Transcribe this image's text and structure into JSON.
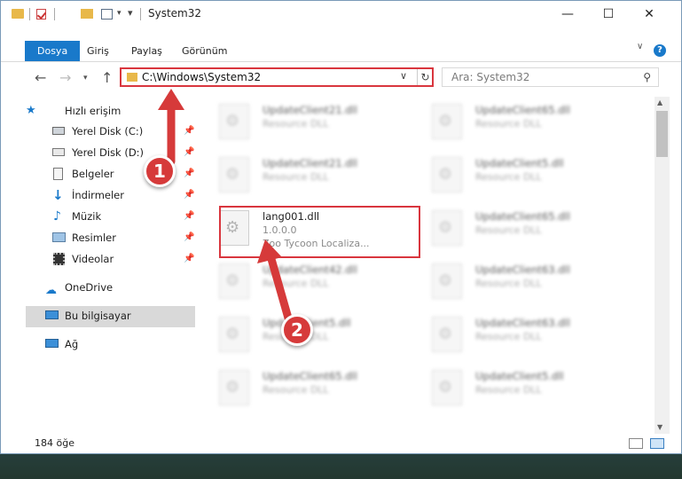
{
  "window": {
    "title": "System32"
  },
  "ribbon": {
    "tabs": [
      "Dosya",
      "Giriş",
      "Paylaş",
      "Görünüm"
    ]
  },
  "address": {
    "path": "C:\\Windows\\System32"
  },
  "search": {
    "placeholder": "Ara: System32"
  },
  "sidebar": {
    "quick_access": "Hızlı erişim",
    "items": [
      "Yerel Disk (C:)",
      "Yerel Disk (D:)",
      "Belgeler",
      "İndirmeler",
      "Müzik",
      "Resimler",
      "Videolar"
    ],
    "onedrive": "OneDrive",
    "this_pc": "Bu bilgisayar",
    "network": "Ağ"
  },
  "files": {
    "left": [
      {
        "name": "UpdateClient21.dll",
        "desc": "Resource DLL"
      },
      {
        "name": "UpdateClient21.dll",
        "desc": "Resource DLL"
      },
      {
        "name": "lang001.dll",
        "desc": "1.0.0.0",
        "desc2": "Zoo Tycoon Localiza..."
      },
      {
        "name": "UpdateClient42.dll",
        "desc": "Resource DLL"
      },
      {
        "name": "UpdateClient5.dll",
        "desc": "Resource DLL"
      },
      {
        "name": "UpdateClient65.dll",
        "desc": "Resource DLL"
      }
    ],
    "right": [
      {
        "name": "UpdateClient65.dll",
        "desc": "Resource DLL"
      },
      {
        "name": "UpdateClient5.dll",
        "desc": "Resource DLL"
      },
      {
        "name": "UpdateClient65.dll",
        "desc": "Resource DLL"
      },
      {
        "name": "UpdateClient63.dll",
        "desc": "Resource DLL"
      },
      {
        "name": "UpdateClient63.dll",
        "desc": "Resource DLL"
      },
      {
        "name": "UpdateClient5.dll",
        "desc": "Resource DLL"
      }
    ]
  },
  "status": {
    "count": "184 öğe"
  },
  "callouts": [
    "1",
    "2"
  ],
  "colors": {
    "accent": "#1979ca",
    "callout": "#d63a3a"
  }
}
